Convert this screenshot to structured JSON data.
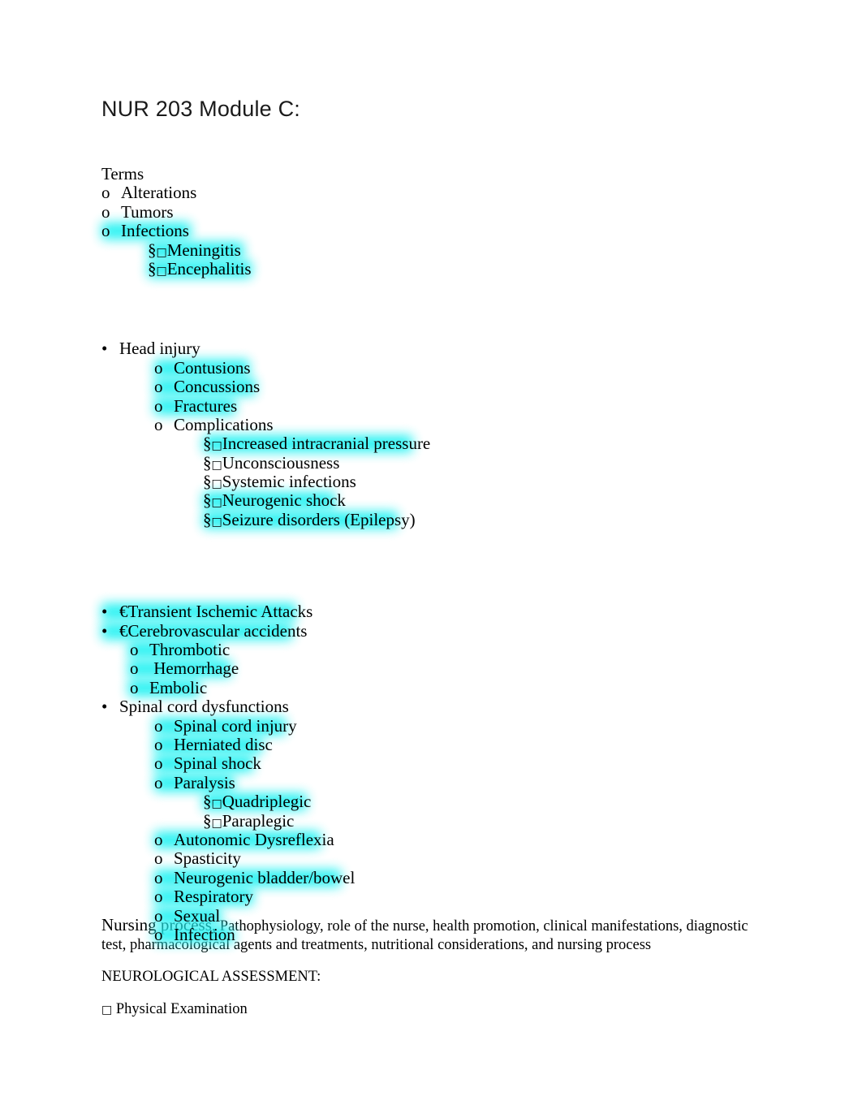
{
  "document": {
    "title": "NUR 203 Module C:",
    "highlight_color": "#22f2f2",
    "section_terms_heading": "Terms",
    "bullets": {
      "disc": "•",
      "circle": "o",
      "section": "§",
      "euro": "€",
      "notdef_box": "□"
    }
  },
  "outline": {
    "terms": {
      "heading": "Terms",
      "items": [
        {
          "bullet": "o",
          "text": "Alterations",
          "highlighted": false
        },
        {
          "bullet": "o",
          "text": "Tumors",
          "highlighted": false
        },
        {
          "bullet": "o",
          "text": "Infections",
          "highlighted": true
        }
      ],
      "infection_subitems": [
        {
          "bullet": "§",
          "text": "Meningitis",
          "highlighted": true
        },
        {
          "bullet": "§",
          "text": "Encephalitis",
          "highlighted": true
        }
      ]
    },
    "head_injury": {
      "bullet": "•",
      "text": "Head injury",
      "highlighted": false,
      "items": [
        {
          "bullet": "o",
          "text": "Contusions",
          "highlighted": true
        },
        {
          "bullet": "o",
          "text": "Concussions",
          "highlighted": true
        },
        {
          "bullet": "o",
          "text": "Fractures",
          "highlighted": true
        },
        {
          "bullet": "o",
          "text": "Complications",
          "highlighted": false
        }
      ],
      "complication_subitems": [
        {
          "bullet": "§",
          "text": "Increased intracranial pressure",
          "highlighted": true
        },
        {
          "bullet": "§",
          "text": "Unconsciousness",
          "highlighted": false
        },
        {
          "bullet": "§",
          "text": "Systemic infections",
          "highlighted": false
        },
        {
          "bullet": "§",
          "text": "Neurogenic shock",
          "highlighted": true
        },
        {
          "bullet": "§",
          "text": "Seizure disorders (Epilepsy)",
          "highlighted": true
        }
      ]
    },
    "vascular": {
      "tia": {
        "bullet": "•",
        "marker": "€",
        "text": "Transient Ischemic Attacks",
        "highlighted": true
      },
      "cva": {
        "bullet": "•",
        "marker": "€",
        "text": "Cerebrovascular accidents",
        "highlighted": true
      },
      "cva_items": [
        {
          "bullet": "o",
          "text": "Thrombotic",
          "highlighted": true
        },
        {
          "bullet": "o",
          "text": " Hemorrhage",
          "highlighted": true
        },
        {
          "bullet": "o",
          "text": "Embolic",
          "highlighted": true
        }
      ]
    },
    "spinal": {
      "bullet": "•",
      "text": "Spinal cord dysfunctions",
      "highlighted": false,
      "items": [
        {
          "bullet": "o",
          "text": "Spinal cord injury",
          "highlighted": true
        },
        {
          "bullet": "o",
          "text": "Herniated disc",
          "highlighted": true
        },
        {
          "bullet": "o",
          "text": "Spinal shock",
          "highlighted": true
        },
        {
          "bullet": "o",
          "text": "Paralysis",
          "highlighted": true
        }
      ],
      "paralysis_subitems": [
        {
          "bullet": "§",
          "text": "Quadriplegic",
          "highlighted": true
        },
        {
          "bullet": "§",
          "text": "Paraplegic",
          "highlighted": false
        }
      ],
      "items_cont": [
        {
          "bullet": "o",
          "text": "Autonomic Dysreflexia",
          "highlighted": true
        },
        {
          "bullet": "o",
          "text": "Spasticity",
          "highlighted": false
        },
        {
          "bullet": "o",
          "text": "Neurogenic bladder/bowel",
          "highlighted": true
        },
        {
          "bullet": "o",
          "text": "Respiratory",
          "highlighted": true
        },
        {
          "bullet": "o",
          "text": "Sexual",
          "highlighted": true
        },
        {
          "bullet": "o",
          "text": "Infection",
          "highlighted": true
        }
      ]
    }
  },
  "paragraphs": {
    "nursing_lead": "Nursing process,",
    "nursing_rest": " Pathophysiology, role of the nurse, health promotion, clinical manifestations, diagnostic test, pharmacological agents and treatments, nutritional considerations, and nursing process",
    "assessment_heading": "NEUROLOGICAL ASSESSMENT:",
    "physical_exam": " Physical Examination"
  }
}
